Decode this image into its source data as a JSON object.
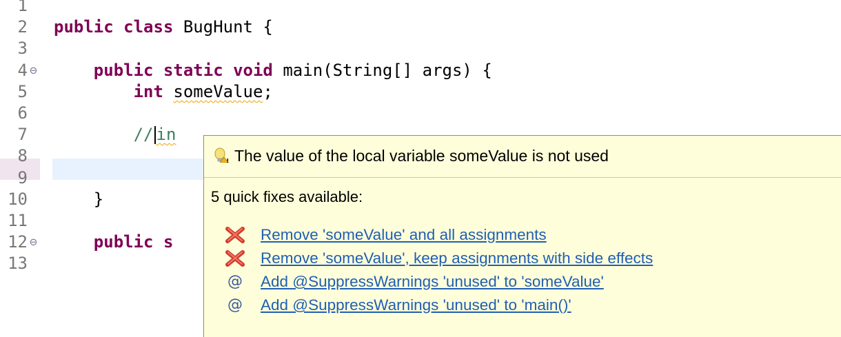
{
  "editor": {
    "lines": [
      {
        "num": "1",
        "fold": "",
        "parts": []
      },
      {
        "num": "2",
        "fold": "",
        "parts": [
          {
            "t": "kw",
            "v": "public class"
          },
          {
            "t": "plain",
            "v": " BugHunt {"
          }
        ]
      },
      {
        "num": "3",
        "fold": "",
        "parts": []
      },
      {
        "num": "4",
        "fold": "⊖",
        "parts": [
          {
            "t": "plain",
            "v": "    "
          },
          {
            "t": "kw",
            "v": "public static void"
          },
          {
            "t": "plain",
            "v": " main(String[] args) {"
          }
        ]
      },
      {
        "num": "5",
        "fold": "",
        "parts": [
          {
            "t": "plain",
            "v": "        "
          },
          {
            "t": "kw",
            "v": "int"
          },
          {
            "t": "plain",
            "v": " "
          },
          {
            "t": "warn",
            "v": "someValue"
          },
          {
            "t": "plain",
            "v": ";"
          }
        ]
      },
      {
        "num": "6",
        "fold": "",
        "parts": []
      },
      {
        "num": "7",
        "fold": "",
        "parts": [
          {
            "t": "comment",
            "v": "        //"
          },
          {
            "t": "caret",
            "v": ""
          },
          {
            "t": "comment-warn",
            "v": "in"
          }
        ]
      },
      {
        "num": "8",
        "fold": "",
        "parts": []
      },
      {
        "num": "9",
        "fold": "",
        "parts": []
      },
      {
        "num": "10",
        "fold": "",
        "parts": [
          {
            "t": "plain",
            "v": "    }"
          }
        ]
      },
      {
        "num": "11",
        "fold": "",
        "parts": []
      },
      {
        "num": "12",
        "fold": "⊖",
        "parts": [
          {
            "t": "plain",
            "v": "    "
          },
          {
            "t": "kw",
            "v": "public s"
          }
        ]
      },
      {
        "num": "13",
        "fold": "",
        "parts": []
      }
    ]
  },
  "popup": {
    "title": "The value of the local variable someValue is not used",
    "subtitle": "5 quick fixes available:",
    "fixes": [
      {
        "icon": "remove-icon",
        "label": "Remove 'someValue' and all assignments"
      },
      {
        "icon": "remove-icon",
        "label": "Remove 'someValue', keep assignments with side effects"
      },
      {
        "icon": "annotation-icon",
        "label": "Add @SuppressWarnings 'unused' to 'someValue'"
      },
      {
        "icon": "annotation-icon",
        "label": "Add @SuppressWarnings 'unused' to 'main()'"
      }
    ]
  },
  "colors": {
    "keyword": "#7f0055",
    "comment": "#3f7f5f",
    "popup_bg": "#fffeda",
    "link": "#1f5fb3",
    "remove_icon": "#d23c2a",
    "current_line": "#e8f2fe"
  }
}
